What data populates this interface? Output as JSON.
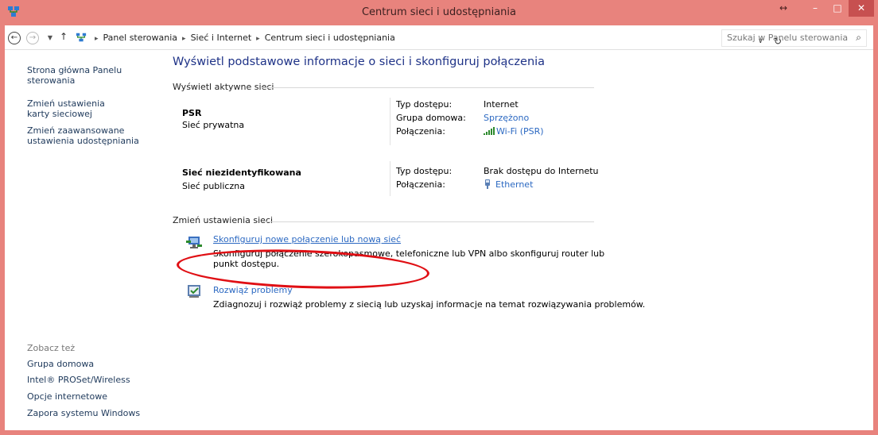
{
  "window": {
    "title": "Centrum sieci i udostępniania",
    "restore_label": "↔",
    "min_label": "–",
    "max_label": "□",
    "close_label": "✕"
  },
  "nav": {
    "back": "←",
    "forward": "→",
    "recent": "▼",
    "up": "↑",
    "dropdown": "∨",
    "refresh": "↻"
  },
  "address": {
    "crumbs": [
      "Panel sterowania",
      "Sieć i Internet",
      "Centrum sieci i udostępniania"
    ],
    "sep": "▸"
  },
  "search": {
    "placeholder": "Szukaj w Panelu sterowania",
    "icon": "⌕"
  },
  "sidebar": {
    "home_link": "Strona główna Panelu sterowania",
    "adapter_link": "Zmień ustawienia karty sieciowej",
    "sharing_link": "Zmień zaawansowane ustawienia udostępniania",
    "see_also_heading": "Zobacz też",
    "see_also": [
      "Grupa domowa",
      "Intel® PROSet/Wireless",
      "Opcje internetowe",
      "Zapora systemu Windows"
    ]
  },
  "main": {
    "heading": "Wyświetl podstawowe informacje o sieci i skonfiguruj połączenia",
    "active_label": "Wyświetl aktywne sieci",
    "networks": [
      {
        "name": "PSR",
        "type": "Sieć prywatna",
        "access_key": "Typ dostępu:",
        "access_val": "Internet",
        "homegroup_key": "Grupa domowa:",
        "homegroup_val": "Sprzężono",
        "conn_key": "Połączenia:",
        "conn_val": "Wi-Fi (PSR)"
      },
      {
        "name": "Sieć niezidentyfikowana",
        "type": "Sieć publiczna",
        "access_key": "Typ dostępu:",
        "access_val": "Brak dostępu do Internetu",
        "conn_key": "Połączenia:",
        "conn_val": "Ethernet"
      }
    ],
    "change_label": "Zmień ustawienia sieci",
    "tasks": [
      {
        "link": "Skonfiguruj nowe połączenie lub nową sieć",
        "desc": "Skonfiguruj połączenie szerokopasmowe, telefoniczne lub VPN albo skonfiguruj router lub punkt dostępu."
      },
      {
        "link": "Rozwiąż problemy",
        "desc": "Zdiagnozuj i rozwiąż problemy z siecią lub uzyskaj informacje na temat rozwiązywania problemów."
      }
    ]
  },
  "colors": {
    "titlebar": "#e8837d",
    "link": "#2c69c2",
    "heading": "#1e3287",
    "annotation": "#e00f14"
  }
}
